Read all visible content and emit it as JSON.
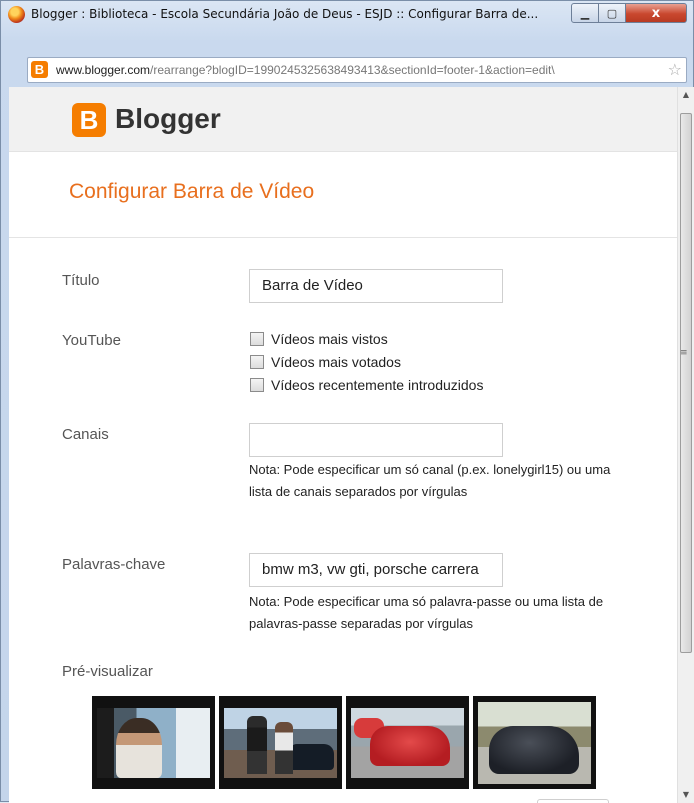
{
  "window": {
    "title": "Blogger : Biblioteca - Escola Secundária João de Deus - ESJD :: Configurar Barra de...",
    "close_label": "x"
  },
  "address": {
    "url_host": "www.blogger.com",
    "url_path": "/rearrange?blogID=1990245325638493413&sectionId=footer-1&action=edit\\"
  },
  "header": {
    "logo_letter": "B",
    "brand": "Blogger"
  },
  "page": {
    "title": "Configurar Barra de Vídeo"
  },
  "form": {
    "titulo": {
      "label": "Título",
      "value": "Barra de Vídeo"
    },
    "youtube": {
      "label": "YouTube",
      "options": [
        "Vídeos mais vistos",
        "Vídeos mais votados",
        "Vídeos recentemente introduzidos"
      ]
    },
    "canais": {
      "label": "Canais",
      "value": "",
      "note": "Nota: Pode especificar um só canal (p.ex. lonelygirl15) ou uma lista de canais separados por vírgulas"
    },
    "palavras": {
      "label": "Palavras-chave",
      "value": "bmw m3,  vw gti,  porsche carrera",
      "note": "Nota: Pode especificar uma só palavra-passe ou uma lista de palavras-passe separadas por vírgulas"
    },
    "preview": {
      "label": "Pré-visualizar"
    }
  },
  "colors": {
    "accent": "#e86f1e",
    "brand_orange": "#f57d00"
  }
}
